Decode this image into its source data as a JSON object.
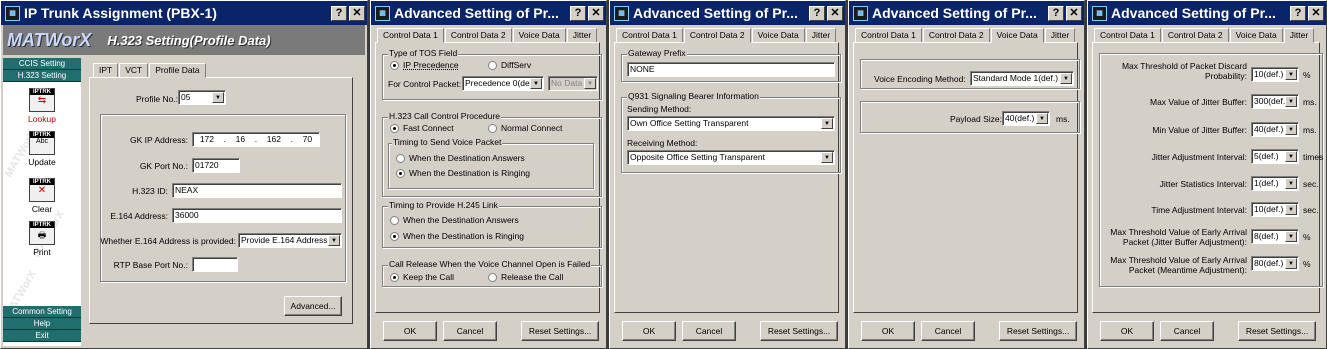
{
  "w1": {
    "title": "IP Trunk Assignment (PBX-1)",
    "brand": "MATWorX",
    "header": "H.323 Setting(Profile Data)",
    "sidebar_top": [
      "CCIS Setting",
      "H.323 Setting"
    ],
    "tools": [
      {
        "badge": "IPTRK",
        "label": "Lookup"
      },
      {
        "badge": "IPTRK",
        "label": "Update"
      },
      {
        "badge": "IPTRK",
        "label": "Clear"
      },
      {
        "badge": "IPTRK",
        "label": "Print"
      }
    ],
    "sidebar_bottom": [
      "Common Setting",
      "Help",
      "Exit"
    ],
    "watermark": "MATWorX",
    "tabs": [
      "IPT",
      "VCT",
      "Profile Data"
    ],
    "profile_label": "Profile No.:",
    "profile_value": "05",
    "gk_ip_label": "GK IP Address:",
    "gk_ip": [
      "172",
      "16",
      "162",
      "70"
    ],
    "gk_port_label": "GK Port No.:",
    "gk_port": "01720",
    "h323id_label": "H.323 ID:",
    "h323id": "NEAX",
    "e164_label": "E.164 Address:",
    "e164": "36000",
    "e164_provided_label": "Whether E.164 Address is provided:",
    "e164_provided": "Provide E.164 Address",
    "rtp_label": "RTP Base Port No.:",
    "rtp": "",
    "advanced": "Advanced..."
  },
  "adv_title": "Advanced Setting of Pr...",
  "adv_tabs": [
    "Control Data 1",
    "Control Data 2",
    "Voice Data",
    "Jitter"
  ],
  "buttons": {
    "ok": "OK",
    "cancel": "Cancel",
    "reset": "Reset Settings..."
  },
  "w2": {
    "tos_group": "Type of TOS Field",
    "ip_precedence": "IP Precedence",
    "diffserv": "DiffServ",
    "control_packet_label": "For Control Packet:",
    "control_packet": "Precedence 0(def.)",
    "no_data": "No Data",
    "call_control_group": "H.323 Call Control Procedure",
    "fast_connect": "Fast Connect",
    "normal_connect": "Normal Connect",
    "timing_voice_group": "Timing to Send Voice Packet",
    "dest_answers": "When the Destination Answers",
    "dest_ringing": "When the Destination is Ringing",
    "h245_group": "Timing to Provide H.245 Link",
    "h245_answers": "When the Destination Answers",
    "h245_ringing": "When the Destination is Ringing",
    "release_group": "Call Release When the Voice Channel Open is Failed",
    "keep_call": "Keep the Call",
    "release_call": "Release the Call"
  },
  "w3": {
    "gateway_group": "Gateway Prefix",
    "gateway": "NONE",
    "q931_group": "Q931 Signaling Bearer Information",
    "sending_label": "Sending Method:",
    "sending": "Own Office Setting Transparent",
    "receiving_label": "Receiving Method:",
    "receiving": "Opposite Office Setting Transparent"
  },
  "w4": {
    "encoding_label": "Voice Encoding Method:",
    "encoding": "Standard Mode 1(def.)",
    "payload_label": "Payload Size:",
    "payload": "40(def.)",
    "payload_unit": "ms."
  },
  "w5": {
    "rows": [
      {
        "label": "Max Threshold of Packet Discard Probability:",
        "value": "10(def.)",
        "unit": "%"
      },
      {
        "label": "Max Value of Jitter Buffer:",
        "value": "300(def.)",
        "unit": "ms."
      },
      {
        "label": "Min Value of Jitter Buffer:",
        "value": "40(def.)",
        "unit": "ms."
      },
      {
        "label": "Jitter Adjustment Interval:",
        "value": "5(def.)",
        "unit": "times"
      },
      {
        "label": "Jitter Statistics Interval:",
        "value": "1(def.)",
        "unit": "sec."
      },
      {
        "label": "Time Adjustment Interval:",
        "value": "10(def.)",
        "unit": "sec."
      },
      {
        "label": "Max Threshold Value of Early Arrival Packet (Jitter Buffer Adjustment):",
        "value": "8(def.)",
        "unit": "%"
      },
      {
        "label": "Max Threshold Value of Early Arrival Packet (Meantime Adjustment):",
        "value": "80(def.)",
        "unit": "%"
      }
    ]
  }
}
